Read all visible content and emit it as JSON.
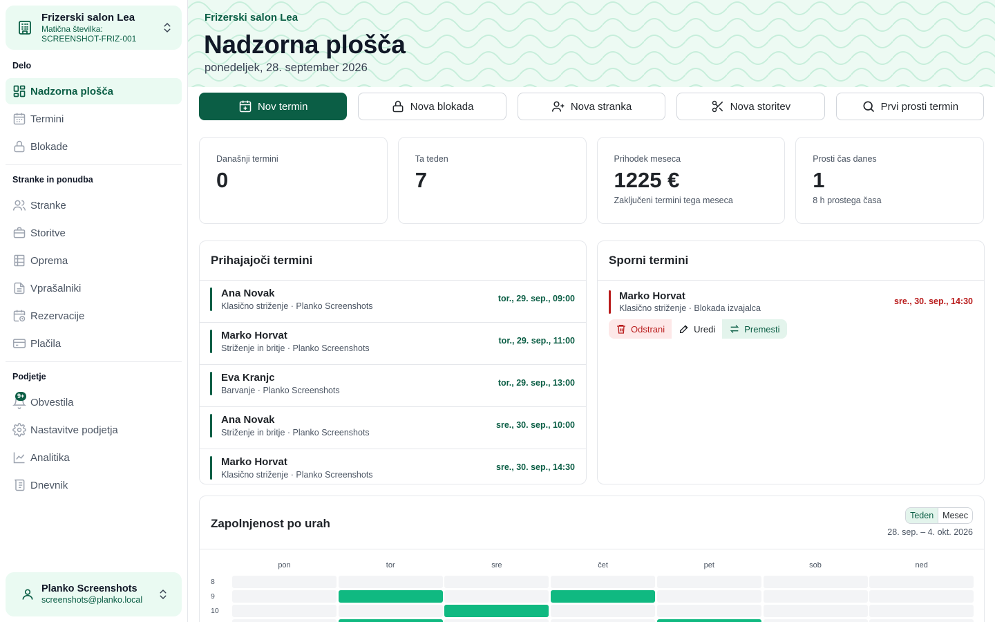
{
  "sidebar": {
    "org": {
      "name": "Frizerski salon Lea",
      "reg_label": "Matična številka:",
      "reg_value": "SCREENSHOT-FRIZ-001"
    },
    "sections": [
      {
        "title": "Delo",
        "items": [
          {
            "label": "Nadzorna plošča",
            "icon": "dashboard-icon",
            "active": true
          },
          {
            "label": "Termini",
            "icon": "calendar-icon"
          },
          {
            "label": "Blokade",
            "icon": "lock-icon"
          }
        ]
      },
      {
        "title": "Stranke in ponudba",
        "items": [
          {
            "label": "Stranke",
            "icon": "users-icon"
          },
          {
            "label": "Storitve",
            "icon": "briefcase-icon"
          },
          {
            "label": "Oprema",
            "icon": "equipment-icon"
          },
          {
            "label": "Vprašalniki",
            "icon": "document-icon"
          },
          {
            "label": "Rezervacije",
            "icon": "calendar-clock-icon"
          },
          {
            "label": "Plačila",
            "icon": "credit-card-icon"
          }
        ]
      },
      {
        "title": "Podjetje",
        "items": [
          {
            "label": "Obvestila",
            "icon": "bell-icon",
            "badge": "9+"
          },
          {
            "label": "Nastavitve podjetja",
            "icon": "gear-icon"
          },
          {
            "label": "Analitika",
            "icon": "chart-line-icon"
          },
          {
            "label": "Dnevnik",
            "icon": "scroll-icon"
          }
        ]
      }
    ],
    "user": {
      "name": "Planko Screenshots",
      "email": "screenshots@planko.local"
    }
  },
  "header": {
    "salon": "Frizerski salon Lea",
    "title": "Nadzorna plošča",
    "date": "ponedeljek, 28. september 2026"
  },
  "actions": [
    {
      "label": "Nov termin",
      "icon": "calendar-plus-icon",
      "primary": true
    },
    {
      "label": "Nova blokada",
      "icon": "lock-icon"
    },
    {
      "label": "Nova stranka",
      "icon": "user-plus-icon"
    },
    {
      "label": "Nova storitev",
      "icon": "scissors-icon"
    },
    {
      "label": "Prvi prosti termin",
      "icon": "search-icon"
    }
  ],
  "stats": [
    {
      "label": "Današnji termini",
      "value": "0",
      "sub": ""
    },
    {
      "label": "Ta teden",
      "value": "7",
      "sub": ""
    },
    {
      "label": "Prihodek meseca",
      "value": "1225 €",
      "sub": "Zaključeni termini tega meseca"
    },
    {
      "label": "Prosti čas danes",
      "value": "1",
      "sub": "8 h prostega časa"
    }
  ],
  "upcoming": {
    "title": "Prihajajoči termini",
    "items": [
      {
        "name": "Ana Novak",
        "detail": "Klasično striženje · Planko Screenshots",
        "time": "tor., 29. sep., 09:00"
      },
      {
        "name": "Marko Horvat",
        "detail": "Striženje in britje · Planko Screenshots",
        "time": "tor., 29. sep., 11:00"
      },
      {
        "name": "Eva Kranjc",
        "detail": "Barvanje · Planko Screenshots",
        "time": "tor., 29. sep., 13:00"
      },
      {
        "name": "Ana Novak",
        "detail": "Striženje in britje · Planko Screenshots",
        "time": "sre., 30. sep., 10:00"
      },
      {
        "name": "Marko Horvat",
        "detail": "Klasično striženje · Planko Screenshots",
        "time": "sre., 30. sep., 14:30"
      }
    ]
  },
  "disputed": {
    "title": "Sporni termini",
    "items": [
      {
        "name": "Marko Horvat",
        "detail": "Klasično striženje · Blokada izvajalca",
        "time": "sre., 30. sep., 14:30",
        "actions": {
          "delete": "Odstrani",
          "edit": "Uredi",
          "move": "Premesti"
        }
      }
    ]
  },
  "occupancy": {
    "title": "Zapolnjenost po urah",
    "toggle": [
      "Teden",
      "Mesec"
    ],
    "toggle_selected": "Teden",
    "range": "28. sep. – 4. okt. 2026",
    "days": [
      "pon",
      "tor",
      "sre",
      "čet",
      "pet",
      "sob",
      "ned"
    ],
    "hours": [
      "8",
      "9",
      "10"
    ],
    "busy": [
      [
        0,
        0,
        0,
        0,
        0,
        0,
        0
      ],
      [
        0,
        1,
        0,
        1,
        0,
        0,
        0
      ],
      [
        0,
        0,
        1,
        0,
        0,
        0,
        0
      ],
      [
        0,
        1,
        0,
        0,
        1,
        0,
        0
      ]
    ]
  },
  "colors": {
    "brand": "#0b5e45",
    "brand_light": "#eafaf2",
    "busy": "#10b981",
    "danger": "#b91c1c"
  }
}
